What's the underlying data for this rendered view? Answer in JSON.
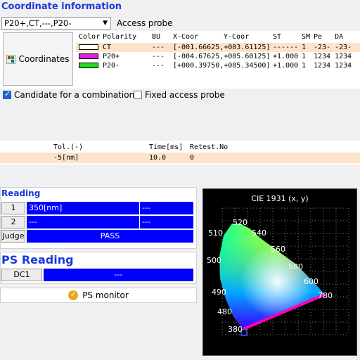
{
  "coordinate_info": {
    "title": "Coordinate information",
    "probe_select_value": "P20+,CT,---,P20-",
    "access_probe_label": "Access probe",
    "coordinates_button_label": "Coordinates",
    "columns": [
      "Color",
      "Polarity",
      "BU",
      "X-Coor",
      "Y-Coor",
      "ST",
      "SM",
      "Pe",
      "DA"
    ],
    "rows": [
      {
        "color": "#ffffff",
        "polarity": "CT",
        "bu": "---",
        "xy": "[-001.66625,+003.61125]",
        "st": "------",
        "sm": "1",
        "pe": "-23-",
        "da": "-23-",
        "selected": true
      },
      {
        "color": "#e020e0",
        "polarity": "P20+",
        "bu": "---",
        "xy": "[-004.67625,+005.60125]",
        "st": "+1.000",
        "sm": "1",
        "pe": "1234",
        "da": "1234",
        "selected": false
      },
      {
        "color": "#22dd22",
        "polarity": "P20-",
        "bu": "---",
        "xy": "[+000.39750,+005.34500]",
        "st": "+1.000",
        "sm": "1",
        "pe": "1234",
        "da": "1234",
        "selected": false
      }
    ],
    "candidate_label": "Candidate for a combination",
    "candidate_checked": true,
    "fixed_probe_label": "Fixed access probe",
    "fixed_probe_checked": false
  },
  "tolerance": {
    "headers": {
      "tol": "Tol.(-)",
      "time": "Time[ms]",
      "retest": "Retest.No"
    },
    "row": {
      "tol": "-5[nm]",
      "time": "10.0",
      "retest": "0"
    }
  },
  "reading": {
    "title": "Reading",
    "rows": [
      {
        "label": "1",
        "value": "350[nm]",
        "extra": "---"
      },
      {
        "label": "2",
        "value": "---",
        "extra": "---"
      }
    ],
    "judge_label": "Judge",
    "judge_value": "PASS"
  },
  "ps_reading": {
    "title": "PS Reading",
    "label": "DC1",
    "value": "---",
    "monitor_label": "PS monitor"
  },
  "chart_data": {
    "type": "scatter",
    "title": "CIE 1931 (x, y)",
    "wavelength_labels": [
      "380",
      "480",
      "490",
      "500",
      "510",
      "520",
      "540",
      "560",
      "580",
      "600",
      "780"
    ],
    "marker": {
      "wavelength": "380"
    }
  }
}
